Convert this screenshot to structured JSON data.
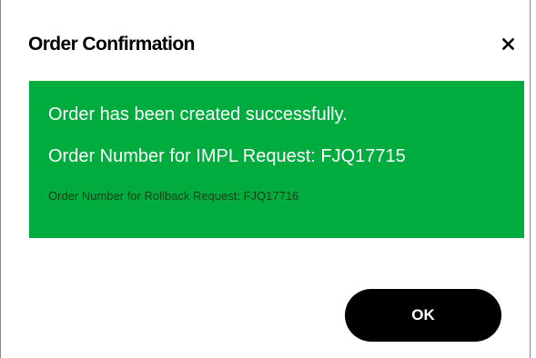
{
  "dialog": {
    "title": "Order Confirmation",
    "close_icon": "close-icon",
    "message": {
      "success": "Order has been created successfully.",
      "impl_order": "Order Number for IMPL Request: FJQ17715",
      "rollback_order": "Order Number for Rollback Request: FJQ17716"
    },
    "ok_label": "OK"
  },
  "colors": {
    "banner_background": "#00ac3e",
    "banner_text": "#ffffff",
    "button_background": "#000000",
    "button_text": "#ffffff"
  }
}
